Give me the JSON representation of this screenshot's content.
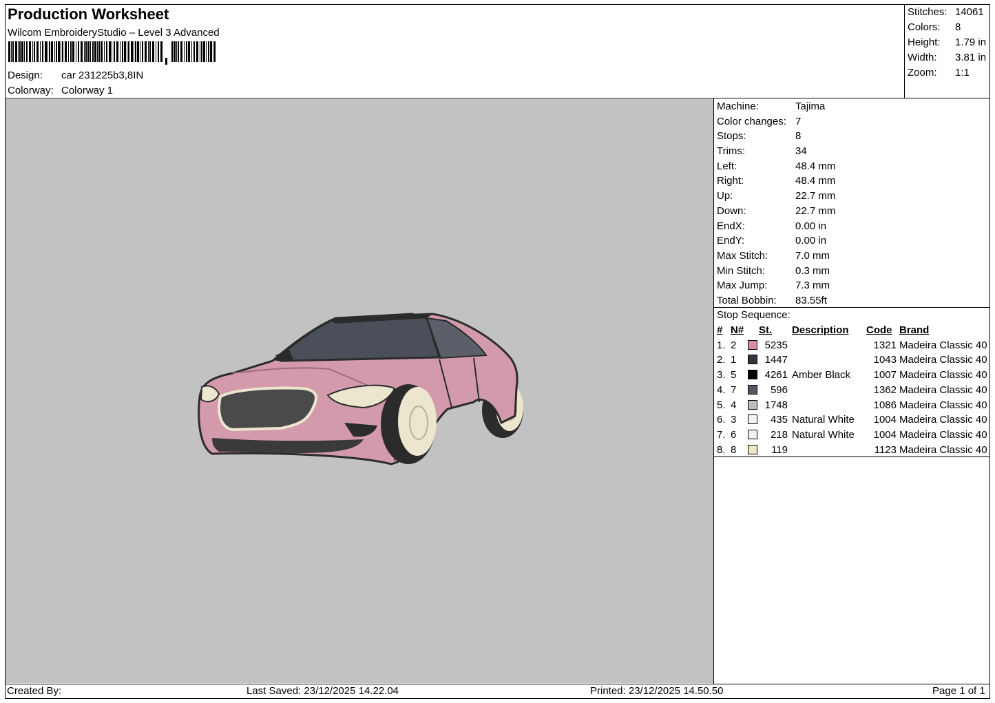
{
  "header": {
    "title": "Production Worksheet",
    "software": "Wilcom EmbroideryStudio – Level 3 Advanced",
    "design_label": "Design:",
    "design_value": "car 231225b3,8IN",
    "colorway_label": "Colorway:",
    "colorway_value": "Colorway 1"
  },
  "summary": [
    {
      "label": "Stitches:",
      "value": "14061"
    },
    {
      "label": "Colors:",
      "value": "8"
    },
    {
      "label": "Height:",
      "value": "1.79 in"
    },
    {
      "label": "Width:",
      "value": "3.81 in"
    },
    {
      "label": "Zoom:",
      "value": "1:1"
    }
  ],
  "machine_info": [
    {
      "label": "Machine:",
      "value": "Tajima"
    },
    {
      "label": "Color changes:",
      "value": "7"
    },
    {
      "label": "Stops:",
      "value": "8"
    },
    {
      "label": "Trims:",
      "value": "34"
    },
    {
      "label": "Left:",
      "value": "48.4 mm"
    },
    {
      "label": "Right:",
      "value": "48.4 mm"
    },
    {
      "label": "Up:",
      "value": "22.7 mm"
    },
    {
      "label": "Down:",
      "value": "22.7 mm"
    },
    {
      "label": "EndX:",
      "value": "0.00 in"
    },
    {
      "label": "EndY:",
      "value": "0.00 in"
    },
    {
      "label": "Max Stitch:",
      "value": "7.0 mm"
    },
    {
      "label": "Min Stitch:",
      "value": "0.3 mm"
    },
    {
      "label": "Max Jump:",
      "value": "7.3 mm"
    },
    {
      "label": "Total Bobbin:",
      "value": "83.55ft"
    }
  ],
  "stop_sequence": {
    "title": "Stop Sequence:",
    "headers": {
      "num": "#",
      "n": "N#",
      "st": "St.",
      "description": "Description",
      "code": "Code",
      "brand": "Brand"
    },
    "rows": [
      {
        "num": "1.",
        "n": "2",
        "color": "#d98bab",
        "st": "5235",
        "description": "",
        "code": "1321",
        "brand": "Madeira Classic 40"
      },
      {
        "num": "2.",
        "n": "1",
        "color": "#2f3440",
        "st": "1447",
        "description": "",
        "code": "1043",
        "brand": "Madeira Classic 40"
      },
      {
        "num": "3.",
        "n": "5",
        "color": "#050505",
        "st": "4261",
        "description": "Amber Black",
        "code": "1007",
        "brand": "Madeira Classic 40"
      },
      {
        "num": "4.",
        "n": "7",
        "color": "#555566",
        "st": "596",
        "description": "",
        "code": "1362",
        "brand": "Madeira Classic 40"
      },
      {
        "num": "5.",
        "n": "4",
        "color": "#bdbdbd",
        "st": "1748",
        "description": "",
        "code": "1086",
        "brand": "Madeira Classic 40"
      },
      {
        "num": "6.",
        "n": "3",
        "color": "#f3f3f3",
        "st": "435",
        "description": "Natural White",
        "code": "1004",
        "brand": "Madeira Classic 40"
      },
      {
        "num": "7.",
        "n": "6",
        "color": "#f3f3f3",
        "st": "218",
        "description": "Natural White",
        "code": "1004",
        "brand": "Madeira Classic 40"
      },
      {
        "num": "8.",
        "n": "8",
        "color": "#f2e6c4",
        "st": "119",
        "description": "",
        "code": "1123",
        "brand": "Madeira Classic 40"
      }
    ]
  },
  "footer": {
    "created_by": "Created By:",
    "last_saved": "Last Saved: 23/12/2025 14.22.04",
    "printed": "Printed: 23/12/2025 14.50.50",
    "page": "Page 1 of 1"
  },
  "colors": {
    "canvas_bg": "#c2c2c2",
    "car_body": "#d29aab",
    "car_outline": "#2b2b2b",
    "window": "#4a4f5a",
    "wheel": "#ece6cf"
  }
}
